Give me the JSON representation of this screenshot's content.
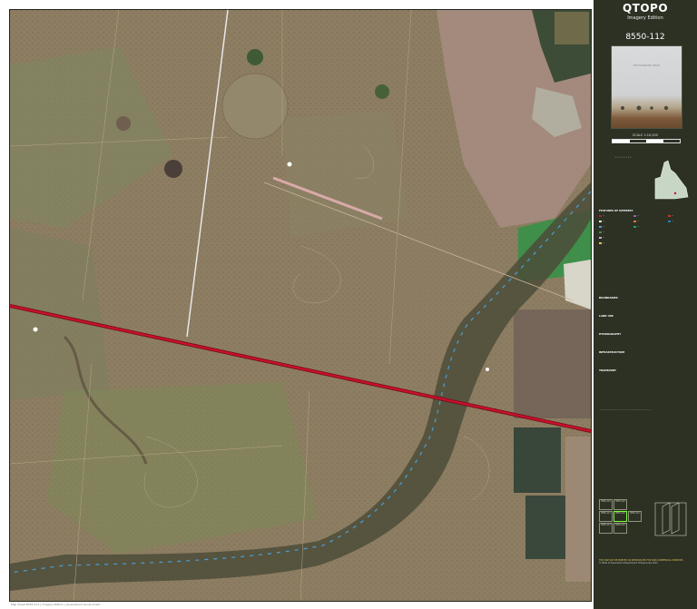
{
  "map": {
    "title": "QTOPO",
    "edition": "Imagery Edition",
    "sheet_number": "8550-112",
    "scale_text": "SCALE 1:10,000",
    "photo_caption": "PHOTOGRAPHIC IMAGE",
    "footer_note": "Map Sheet 8550-112  |  Imagery Edition  |  Queensland Government"
  },
  "colors": {
    "panel_bg": "#2c3124",
    "railway": "#c8102e",
    "road": "#e8e8e8",
    "creek": "#4aa0d8",
    "water_green": "#3f8f4a",
    "farmland_dark": "#3a4a3a",
    "land": "#8a7a5e"
  },
  "legend": {
    "title": "FEATURES OF INTEREST",
    "boundaries_title": "BOUNDARIES",
    "land_use_title": "LAND USE",
    "hydrography_title": "HYDROGRAPHY",
    "infrastructure_title": "INFRASTRUCTURE",
    "transport_title": "TRANSPORT"
  },
  "index": {
    "cells": [
      "8550-114",
      "8550-122",
      "8550-111",
      "8550-112",
      "8550-121",
      "8550-113",
      "8550-123"
    ]
  },
  "disclaimer": {
    "copyright": "© State of Queensland (Department of Resources) 2021",
    "note": "THIS MAP MAY BE PRINTED OR REPRODUCED FOR NON-COMMERCIAL PURPOSES"
  }
}
